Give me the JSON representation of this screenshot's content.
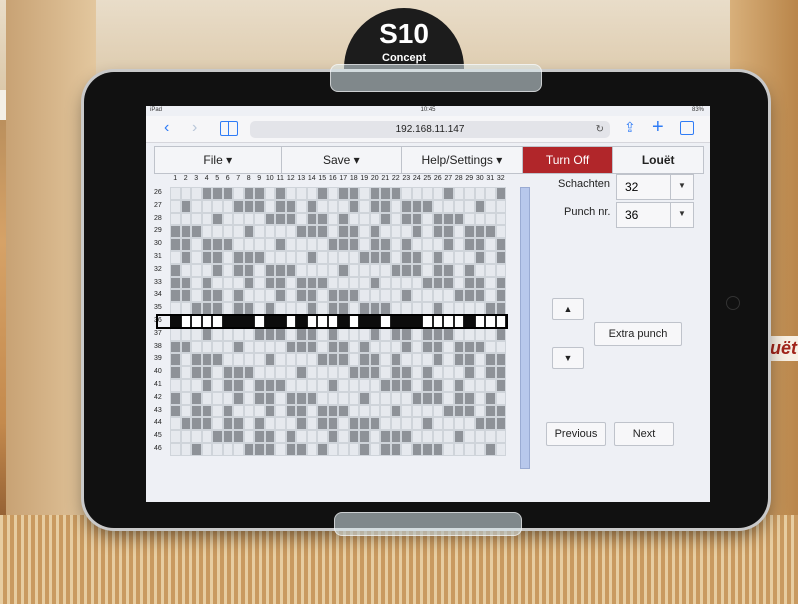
{
  "background": {
    "sign_text": "S10",
    "sign_sub": "Concept",
    "logo": "Louët"
  },
  "status": {
    "carrier": "iPad",
    "time": "10:45",
    "battery": "83%"
  },
  "browser": {
    "url": "192.168.11.147",
    "back_icon": "back-arrow-icon",
    "forward_icon": "forward-arrow-icon",
    "bookmarks_icon": "book-icon",
    "reload_icon": "reload-icon",
    "share_icon": "share-icon",
    "newtab_icon": "plus-icon",
    "tabs_icon": "tabs-icon"
  },
  "menu": {
    "file": "File ▾",
    "save": "Save ▾",
    "help": "Help/Settings ▾",
    "turnoff": "Turn Off",
    "brand": "Louët",
    "turnoff_color": "#b1262a"
  },
  "grid": {
    "columns": [
      "1",
      "2",
      "3",
      "4",
      "5",
      "6",
      "7",
      "8",
      "9",
      "10",
      "11",
      "12",
      "13",
      "14",
      "15",
      "16",
      "17",
      "18",
      "19",
      "20",
      "21",
      "22",
      "23",
      "24",
      "25",
      "26",
      "27",
      "28",
      "29",
      "30",
      "31",
      "32"
    ],
    "rows": [
      "26",
      "27",
      "28",
      "29",
      "30",
      "31",
      "32",
      "33",
      "34",
      "35",
      "36",
      "37",
      "38",
      "39",
      "40",
      "41",
      "42",
      "43",
      "44",
      "45",
      "46"
    ],
    "current_row": "36",
    "current_row_index": 10
  },
  "panel": {
    "shafts_label": "Schachten",
    "shafts_value": "32",
    "punch_label": "Punch nr.",
    "punch_value": "36",
    "up_label": "▲",
    "down_label": "▼",
    "extra_punch": "Extra punch",
    "previous": "Previous",
    "next": "Next"
  }
}
